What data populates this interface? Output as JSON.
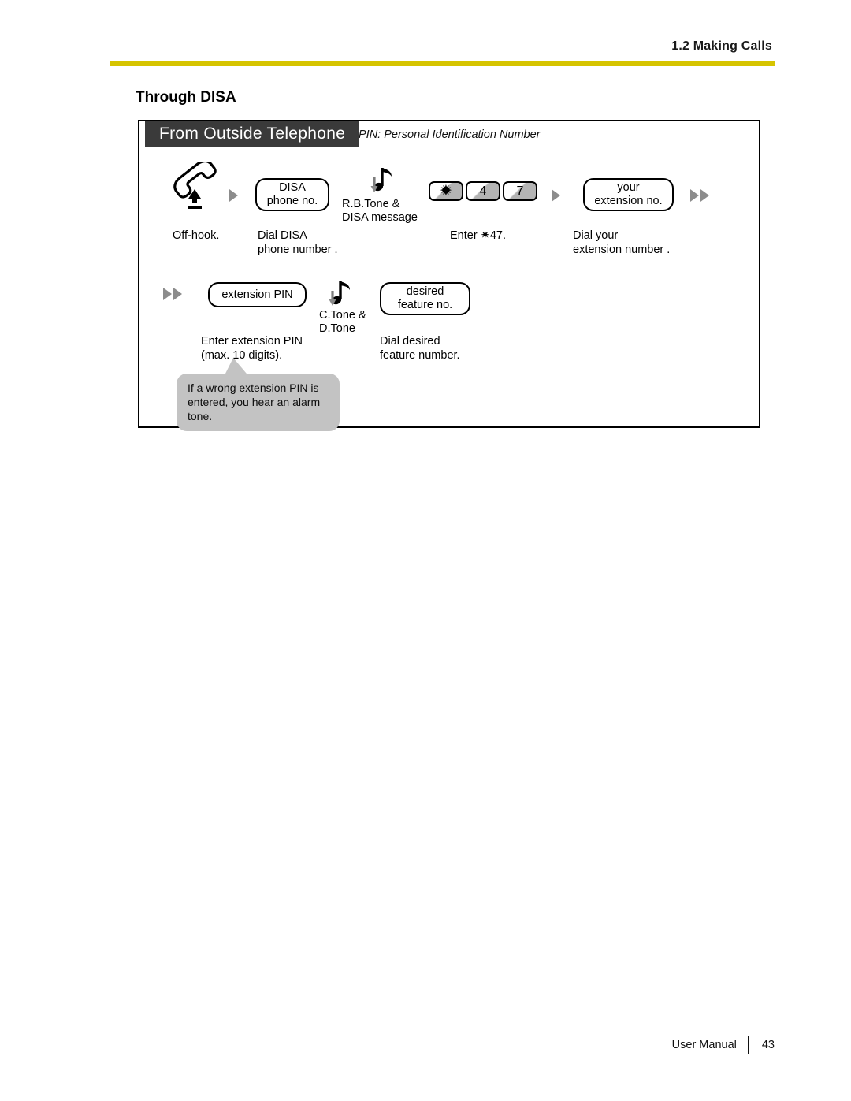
{
  "header": {
    "section_label": "1.2 Making Calls",
    "rule_color": "#d6c400"
  },
  "section": {
    "title": "Through DISA"
  },
  "diagram": {
    "banner_label": "From Outside Telephone",
    "banner_color": "#3a3a3a",
    "pin_note": "PIN: Personal Identification Number",
    "row1": {
      "offhook_caption": "Off-hook.",
      "disa_box": {
        "line1": "DISA",
        "line2": "phone no."
      },
      "disa_caption": "Dial DISA\nphone number  .",
      "tone_label_1": "R.B.Tone &\nDISA message",
      "keypad": [
        "✹",
        "4",
        "7"
      ],
      "keypad_caption": "Enter ✷47.",
      "extension_box": {
        "line1": "your",
        "line2": "extension no."
      },
      "extension_caption": "Dial your\nextension number  ."
    },
    "row2": {
      "pin_box": {
        "line1": "extension PIN"
      },
      "pin_caption": "Enter extension PIN\n(max. 10 digits).",
      "tone_label_2": "C.Tone &\nD.Tone",
      "feature_box": {
        "line1": "desired",
        "line2": "feature no."
      },
      "feature_caption": "Dial desired\nfeature number."
    },
    "callout": "If a wrong extension PIN is\nentered, you hear an alarm tone."
  },
  "footer": {
    "manual_label": "User Manual",
    "page_number": "43"
  }
}
